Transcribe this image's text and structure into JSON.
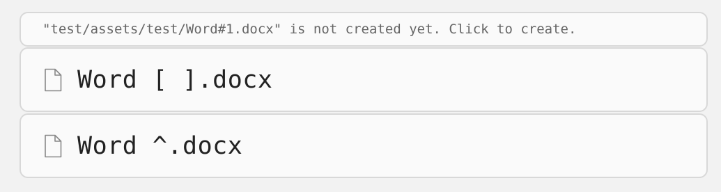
{
  "notice": {
    "text": "\"test/assets/test/Word#1.docx\" is not created yet. Click to create."
  },
  "files": [
    {
      "name": "Word [ ].docx",
      "icon": "file-icon"
    },
    {
      "name": "Word ^.docx",
      "icon": "file-icon"
    }
  ],
  "colors": {
    "background": "#f2f2f2",
    "card": "#fafafa",
    "border": "#d8d8d8",
    "notice_text": "#666666",
    "file_text": "#222222"
  }
}
